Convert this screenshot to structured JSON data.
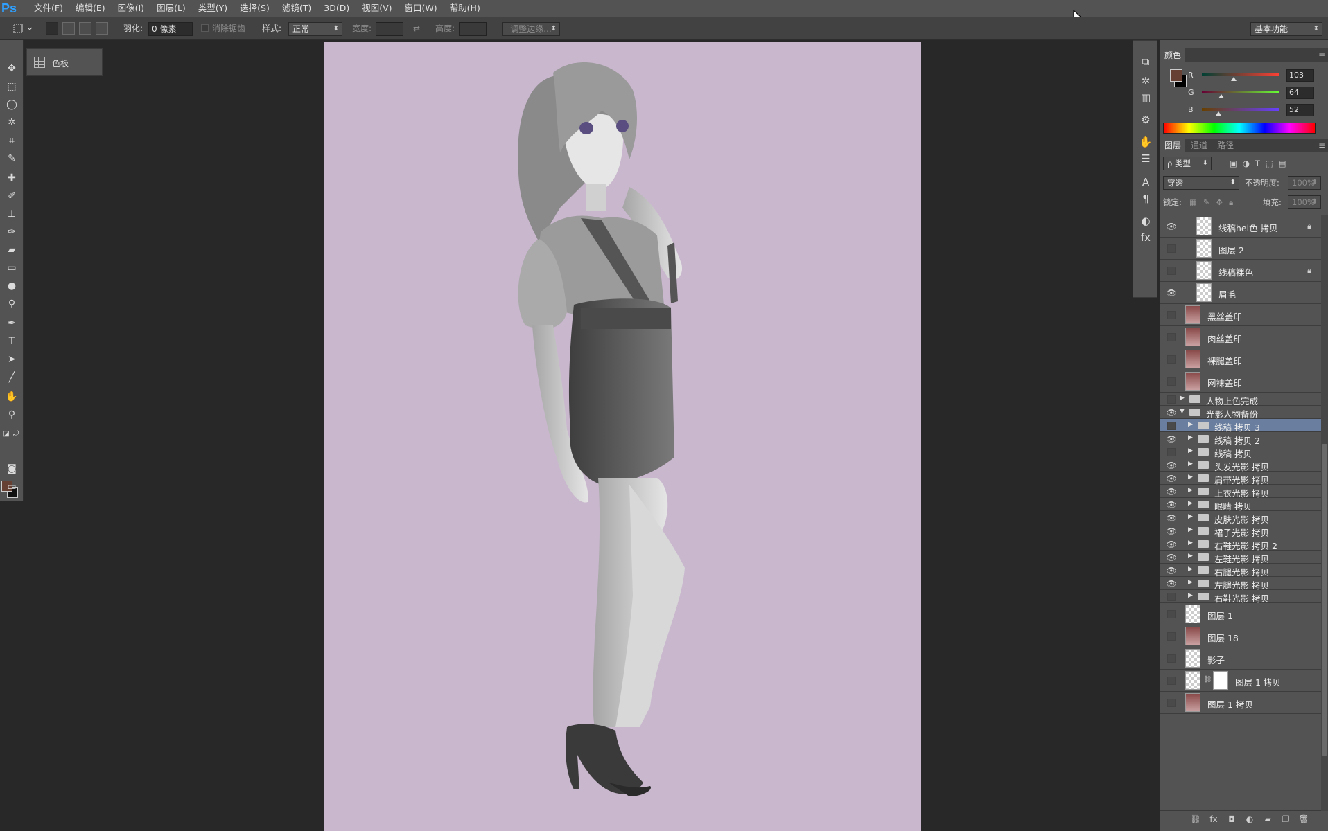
{
  "menubar": {
    "logo": "Ps",
    "items": [
      "文件(F)",
      "编辑(E)",
      "图像(I)",
      "图层(L)",
      "类型(Y)",
      "选择(S)",
      "滤镜(T)",
      "3D(D)",
      "视图(V)",
      "窗口(W)",
      "帮助(H)"
    ]
  },
  "options": {
    "feather_label": "羽化:",
    "feather_value": "0 像素",
    "antialias_label": "消除锯齿",
    "style_label": "样式:",
    "style_value": "正常",
    "width_label": "宽度:",
    "height_label": "高度:",
    "refine_edge_button": "调整边缘...",
    "workspace_value": "基本功能"
  },
  "swatches_panel": {
    "label": "色板"
  },
  "colors": {
    "foreground": "#674034",
    "background": "#111111",
    "canvas_bg": "#c9b7ce"
  },
  "color_panel": {
    "tab": "颜色",
    "r_label": "R",
    "r_value": "103",
    "g_label": "G",
    "g_value": "64",
    "b_label": "B",
    "b_value": "52"
  },
  "layers_panel": {
    "tabs": [
      "图层",
      "通道",
      "路径"
    ],
    "filter_kind": "ρ 类型",
    "blend_mode": "穿透",
    "opacity_label": "不透明度:",
    "opacity_value": "100%",
    "lock_label": "锁定:",
    "fill_label": "填充:",
    "fill_value": "100%",
    "layers": [
      {
        "name": "线稿hei色 拷贝",
        "visible": true,
        "type": "layer",
        "locked": true
      },
      {
        "name": "图层 2",
        "visible": false,
        "type": "layer",
        "locked": false
      },
      {
        "name": "线稿裸色",
        "visible": false,
        "type": "layer",
        "locked": true
      },
      {
        "name": "眉毛",
        "visible": true,
        "type": "layer",
        "locked": false
      },
      {
        "name": "黑丝盖印",
        "visible": false,
        "type": "image",
        "locked": false
      },
      {
        "name": "肉丝盖印",
        "visible": false,
        "type": "image",
        "locked": false
      },
      {
        "name": "裸腿盖印",
        "visible": false,
        "type": "image",
        "locked": false
      },
      {
        "name": "网袜盖印",
        "visible": false,
        "type": "image",
        "locked": false
      },
      {
        "name": "人物上色完成",
        "visible": false,
        "type": "group",
        "open": false
      },
      {
        "name": "光影人物备份",
        "visible": true,
        "type": "group",
        "open": true
      },
      {
        "name": "线稿 拷贝 3",
        "visible": false,
        "type": "subgroup",
        "selected": true
      },
      {
        "name": "线稿 拷贝 2",
        "visible": true,
        "type": "subgroup"
      },
      {
        "name": "线稿 拷贝",
        "visible": false,
        "type": "subgroup"
      },
      {
        "name": "头发光影 拷贝",
        "visible": true,
        "type": "subgroup"
      },
      {
        "name": "肩带光影 拷贝",
        "visible": true,
        "type": "subgroup"
      },
      {
        "name": "上衣光影 拷贝",
        "visible": true,
        "type": "subgroup"
      },
      {
        "name": "眼睛 拷贝",
        "visible": true,
        "type": "subgroup"
      },
      {
        "name": "皮肤光影 拷贝",
        "visible": true,
        "type": "subgroup"
      },
      {
        "name": "裙子光影 拷贝",
        "visible": true,
        "type": "subgroup"
      },
      {
        "name": "右鞋光影 拷贝 2",
        "visible": true,
        "type": "subgroup"
      },
      {
        "name": "左鞋光影 拷贝",
        "visible": true,
        "type": "subgroup"
      },
      {
        "name": "右腿光影 拷贝",
        "visible": true,
        "type": "subgroup"
      },
      {
        "name": "左腿光影 拷贝",
        "visible": true,
        "type": "subgroup"
      },
      {
        "name": "右鞋光影 拷贝",
        "visible": false,
        "type": "subgroup"
      },
      {
        "name": "图层 1",
        "visible": false,
        "type": "layer"
      },
      {
        "name": "图层 18",
        "visible": false,
        "type": "image"
      },
      {
        "name": "影子",
        "visible": false,
        "type": "layer"
      },
      {
        "name": "图层 1 拷贝",
        "visible": false,
        "type": "masked"
      },
      {
        "name": "图层 1 拷贝",
        "visible": false,
        "type": "image"
      }
    ]
  }
}
